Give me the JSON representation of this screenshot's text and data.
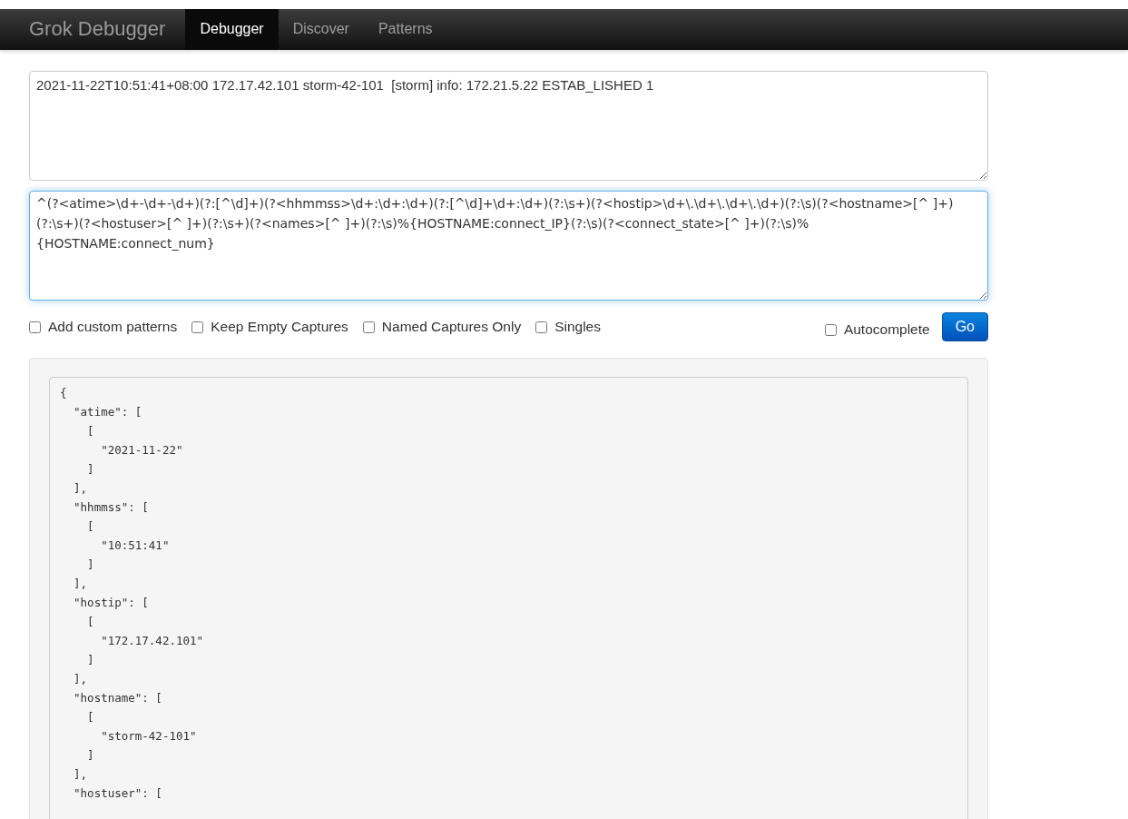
{
  "navbar": {
    "brand": "Grok Debugger",
    "tabs": [
      {
        "label": "Debugger",
        "selected": true
      },
      {
        "label": "Discover",
        "selected": false
      },
      {
        "label": "Patterns",
        "selected": false
      }
    ]
  },
  "input": {
    "value": "2021-11-22T10:51:41+08:00 172.17.42.101 storm-42-101  [storm] info: 172.21.5.22 ESTAB_LISHED 1"
  },
  "pattern": {
    "value": "^(?<atime>\\d+-\\d+-\\d+)(?:[^\\d]+)(?<hhmmss>\\d+:\\d+:\\d+)(?:[^\\d]+\\d+:\\d+)(?:\\s+)(?<hostip>\\d+\\.\\d+\\.\\d+\\.\\d+)(?:\\s)(?<hostname>[^ ]+)(?:\\s+)(?<hostuser>[^ ]+)(?:\\s+)(?<names>[^ ]+)(?:\\s)%{HOSTNAME:connect_IP}(?:\\s)(?<connect_state>[^ ]+)(?:\\s)%{HOSTNAME:connect_num}"
  },
  "options": [
    {
      "label": "Add custom patterns",
      "checked": false
    },
    {
      "label": "Keep Empty Captures",
      "checked": false
    },
    {
      "label": "Named Captures Only",
      "checked": false
    },
    {
      "label": "Singles",
      "checked": false
    }
  ],
  "autocomplete": {
    "label": "Autocomplete",
    "checked": false
  },
  "go_button": "Go",
  "output": {
    "lines": [
      "{",
      "  \"atime\": [",
      "    [",
      "      \"2021-11-22\"",
      "    ]",
      "  ],",
      "  \"hhmmss\": [",
      "    [",
      "      \"10:51:41\"",
      "    ]",
      "  ],",
      "  \"hostip\": [",
      "    [",
      "      \"172.17.42.101\"",
      "    ]",
      "  ],",
      "  \"hostname\": [",
      "    [",
      "      \"storm-42-101\"",
      "    ]",
      "  ],",
      "  \"hostuser\": ["
    ]
  }
}
